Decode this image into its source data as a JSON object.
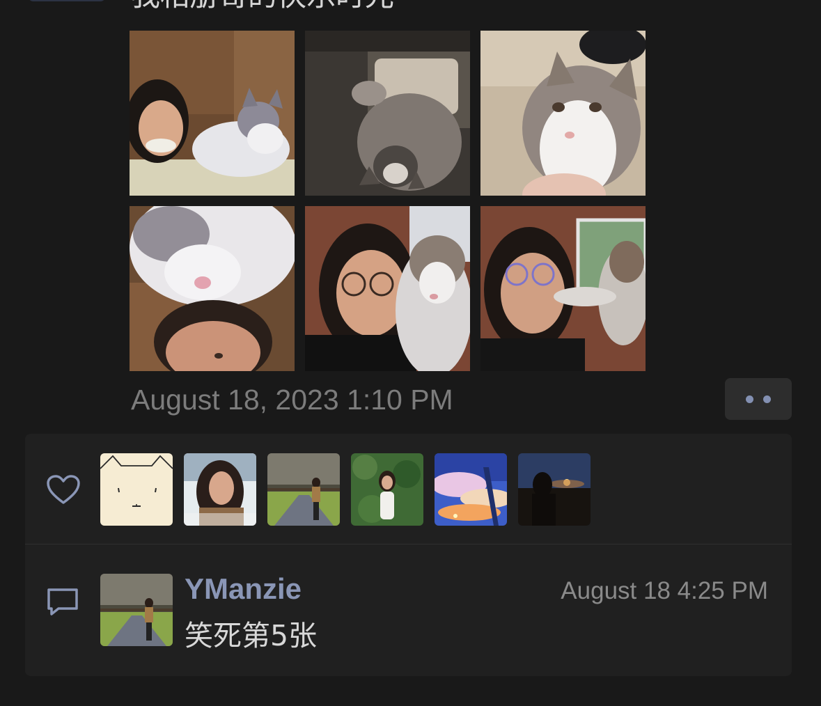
{
  "post": {
    "text": "我相册哥的快乐时光",
    "time": "August 18, 2023 1:10 PM",
    "photos": [
      {
        "icon": "photo-cat-woman-bed"
      },
      {
        "icon": "photo-cat-lying"
      },
      {
        "icon": "photo-cat-closeup"
      },
      {
        "icon": "photo-cat-on-head"
      },
      {
        "icon": "photo-selfie-with-cat"
      },
      {
        "icon": "photo-cat-pawing-face"
      }
    ]
  },
  "more_button": {
    "icon": "more-dots-icon"
  },
  "likes": {
    "icon": "heart-icon",
    "avatars": [
      {
        "icon": "cartoon-cat-avatar"
      },
      {
        "icon": "woman-snow-avatar"
      },
      {
        "icon": "woman-path-avatar"
      },
      {
        "icon": "woman-garden-avatar"
      },
      {
        "icon": "anime-sky-avatar"
      },
      {
        "icon": "sunset-silhouette-avatar"
      }
    ]
  },
  "comment": {
    "icon": "comment-icon",
    "author": "YManzie",
    "time": "August 18 4:25 PM",
    "text": "笑死第5张"
  },
  "colors": {
    "background": "#191919",
    "panel": "#202020",
    "link_blue": "#8a96b6",
    "secondary_text": "#7c7c7c"
  }
}
